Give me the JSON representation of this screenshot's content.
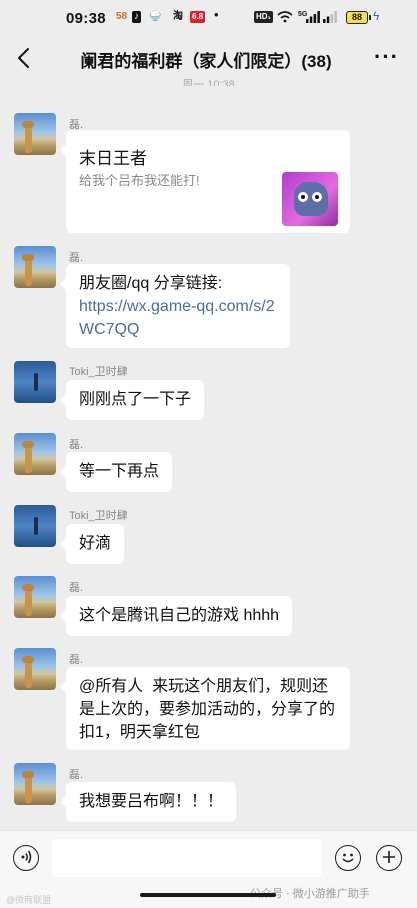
{
  "status_bar": {
    "time": "09:38",
    "app_badges": [
      "58",
      "♪",
      "🍚",
      "淘",
      "6.8"
    ],
    "dot": "•",
    "hd": "HD₁",
    "signal": "5G",
    "battery": "88"
  },
  "nav": {
    "title": "阑君的福利群（家人们限定）(38)",
    "more": "···",
    "timestamp": "周一 10:38"
  },
  "messages": [
    {
      "sender": "磊.",
      "type": "card",
      "card_title": "末日王者",
      "card_desc": "给我个吕布我还能打!"
    },
    {
      "sender": "磊.",
      "type": "text",
      "text": "朋友圈/qq 分享链接:",
      "link": "https://wx.game-qq.com/s/2WC7QQ"
    },
    {
      "sender": "Toki_卫时肆",
      "type": "text",
      "text": "刚刚点了一下子"
    },
    {
      "sender": "磊.",
      "type": "text",
      "text": "等一下再点"
    },
    {
      "sender": "Toki_卫时肆",
      "type": "text",
      "text": "好滴"
    },
    {
      "sender": "磊.",
      "type": "text",
      "text": "这个是腾讯自己的游戏 hhhh"
    },
    {
      "sender": "磊.",
      "type": "text",
      "text": "@所有人  来玩这个朋友们，规则还是上次的，要参加活动的，分享了的扣1，明天拿红包"
    },
    {
      "sender": "磊.",
      "type": "text",
      "text": "我想要吕布啊！！！"
    }
  ],
  "input_bar": {
    "voice_icon": "voice-icon",
    "emoji_icon": "emoji-icon",
    "plus_icon": "plus-icon"
  },
  "watermark": "公众号 · 微小游推广助手",
  "corner_watermark": "@微商联盟"
}
